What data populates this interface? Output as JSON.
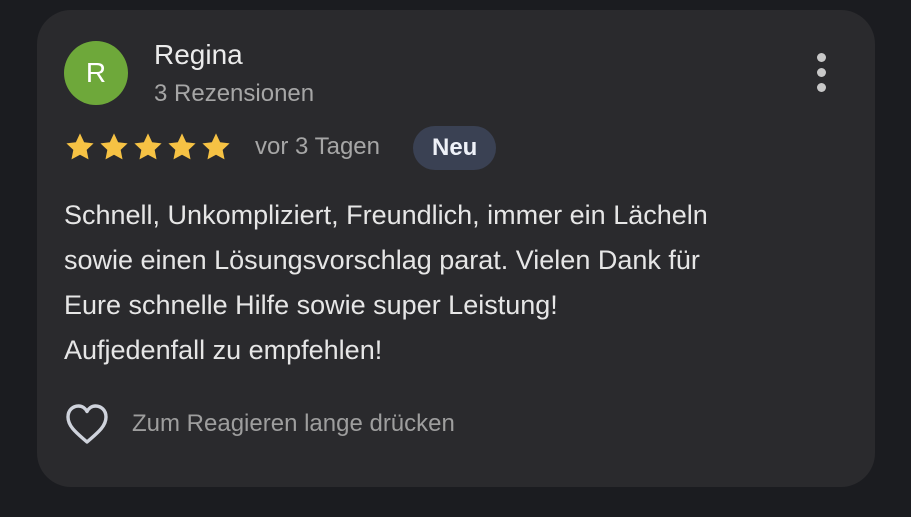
{
  "review": {
    "avatar_initial": "R",
    "avatar_color": "#6ea83a",
    "author_name": "Regina",
    "review_count": "3 Rezensionen",
    "rating": 5,
    "rating_max": 5,
    "star_color": "#f6c244",
    "date": "vor 3 Tagen",
    "badge": "Neu",
    "text": "Schnell, Unkompliziert, Freundlich, immer ein Lächeln\nsowie einen Lösungsvorschlag parat. Vielen Dank für\nEure schnelle Hilfe sowie super Leistung!\nAufjedenfall zu empfehlen!",
    "react_hint": "Zum Reagieren lange drücken",
    "more_icon": "more-vertical-icon",
    "heart_icon": "heart-outline-icon"
  }
}
